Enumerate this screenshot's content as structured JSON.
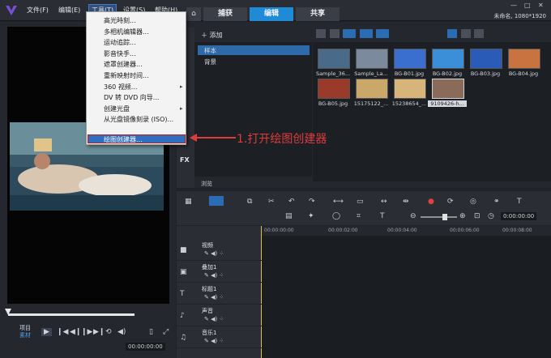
{
  "menubar": {
    "items": [
      "文件(F)",
      "编辑(E)",
      "工具(T)",
      "设置(S)",
      "帮助(H)"
    ],
    "title_info": "未命名, 1080*1920",
    "win_controls": [
      "—",
      "□",
      "✕"
    ]
  },
  "tabs": {
    "home_icon": "home-icon",
    "items": [
      "捕获",
      "编辑",
      "共享"
    ],
    "selected": "编辑"
  },
  "tools_menu": {
    "items": [
      {
        "label": "高光時刻...",
        "submenu": false
      },
      {
        "label": "多相机编辑器...",
        "submenu": false
      },
      {
        "label": "运动追踪...",
        "submenu": false
      },
      {
        "label": "影音快手...",
        "submenu": false
      },
      {
        "label": "遮罩创建器...",
        "submenu": false
      },
      {
        "label": "重新映射时间...",
        "submenu": false
      },
      {
        "label": "360 视频...",
        "submenu": true
      },
      {
        "label": "DV 转 DVD 向导...",
        "submenu": false
      },
      {
        "label": "创建光盘",
        "submenu": true
      },
      {
        "label": "从光盘镜像刻录 (ISO)...",
        "submenu": false
      },
      {
        "label": "绘图创建器...",
        "submenu": false
      }
    ],
    "highlighted": "绘图创建器..."
  },
  "annotation": {
    "text": "1.打开绘图创建器",
    "color": "#e03b3b"
  },
  "library": {
    "add_label": "添加",
    "folders": [
      "样本",
      "背景"
    ],
    "selected_folder": "样本",
    "browse_label": "浏览",
    "fx_label": "FX",
    "thumbnails": [
      {
        "label": "Sample_36...",
        "color": "#4a6a8a"
      },
      {
        "label": "Sample_La...",
        "color": "#7b8a9c"
      },
      {
        "label": "BG-B01.jpg",
        "color": "#3a6fcf"
      },
      {
        "label": "BG-B02.jpg",
        "color": "#3b8ed8"
      },
      {
        "label": "BG-B03.jpg",
        "color": "#2a5bb6"
      },
      {
        "label": "BG-B04.jpg",
        "color": "#c87340"
      },
      {
        "label": "BG-B05.jpg",
        "color": "#9a3a2a"
      },
      {
        "label": "15175122_...",
        "color": "#caa86a"
      },
      {
        "label": "15238654_...",
        "color": "#d7b47a"
      },
      {
        "label": "9109426-h...",
        "color": "#8a6a58"
      }
    ]
  },
  "preview": {
    "project_label": "项目",
    "clip_label": "素材",
    "timecode": "00:00:00:00",
    "controls": [
      "play-icon",
      "prev-icon",
      "step-back-icon",
      "step-forward-icon",
      "next-icon",
      "repeat-icon",
      "volume-icon"
    ]
  },
  "timeline": {
    "timecode": "0:00:00:00",
    "ruler": [
      "00:00:00:00",
      "00:00:02:00",
      "00:00:04:00",
      "00:00:06:00",
      "00:00:08:00"
    ],
    "tracks": [
      "视频",
      "叠加1",
      "标题1",
      "声音",
      "音乐1"
    ]
  }
}
